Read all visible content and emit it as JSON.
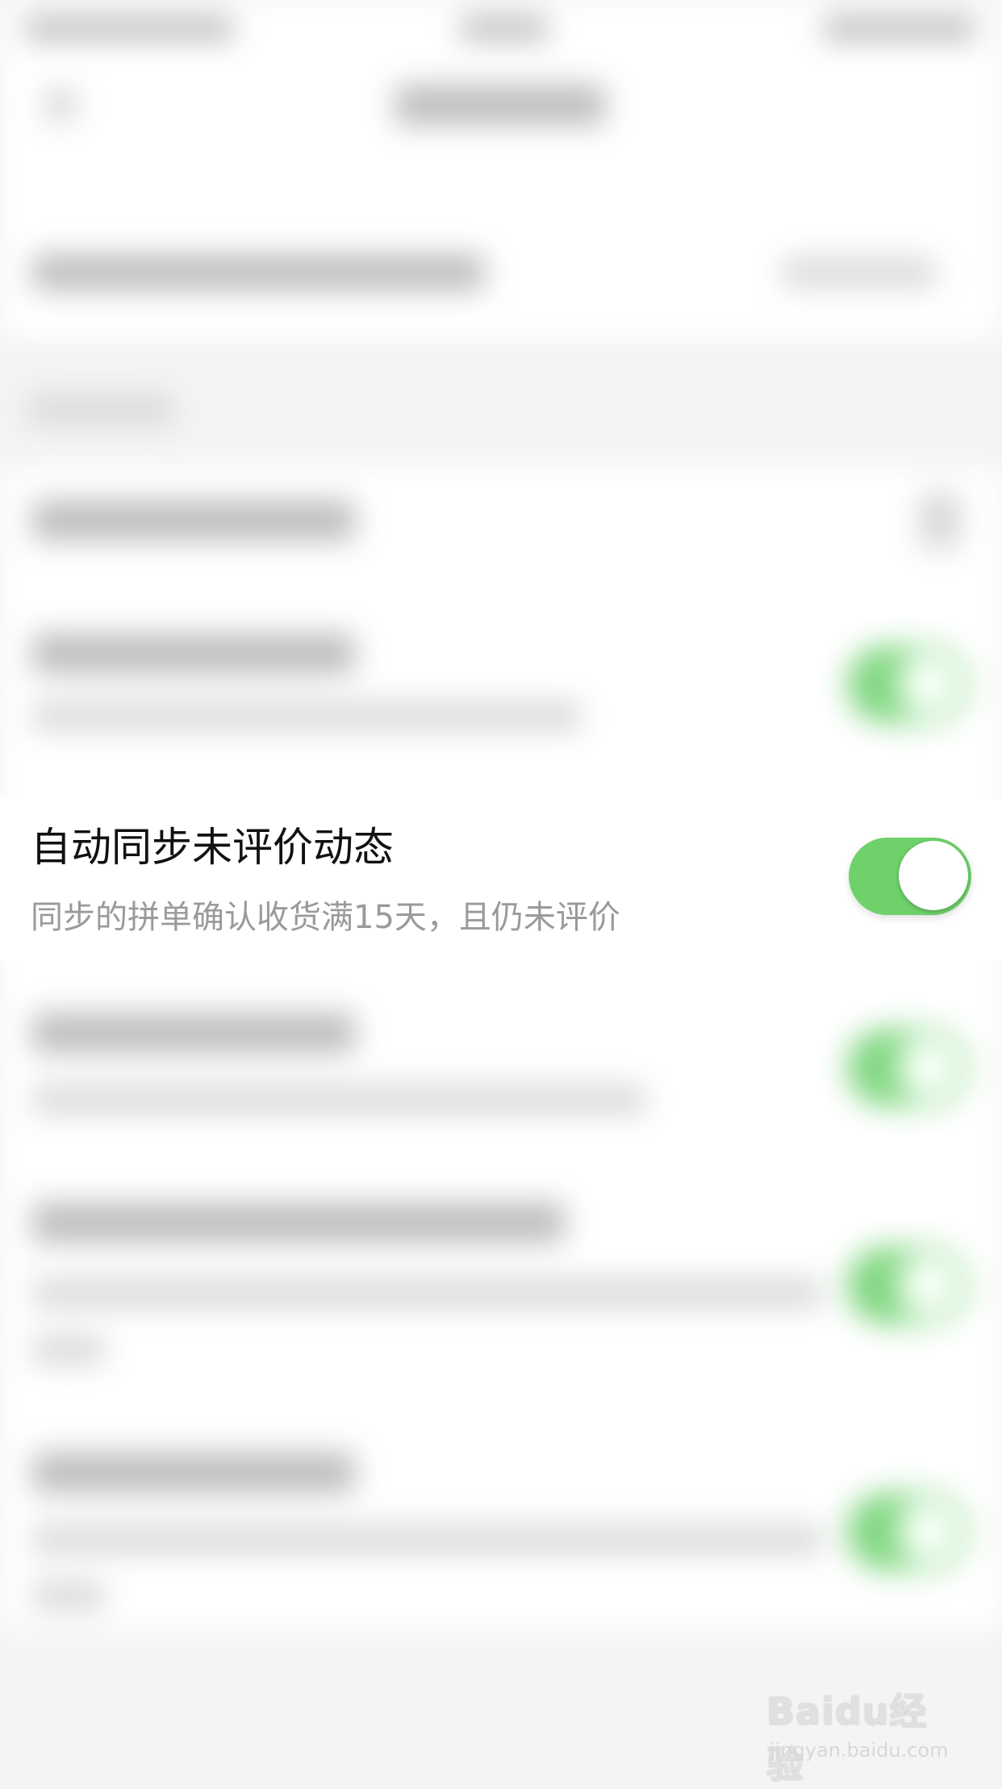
{
  "setting": {
    "title": "自动同步未评价动态",
    "description": "同步的拼单确认收货满15天，且仍未评价",
    "enabled": true
  },
  "watermark": {
    "logo": "Baidu经验",
    "url": "jingyan.baidu.com"
  },
  "colors": {
    "toggle_on": "#6fd16a",
    "page_bg": "#f4f4f4"
  }
}
